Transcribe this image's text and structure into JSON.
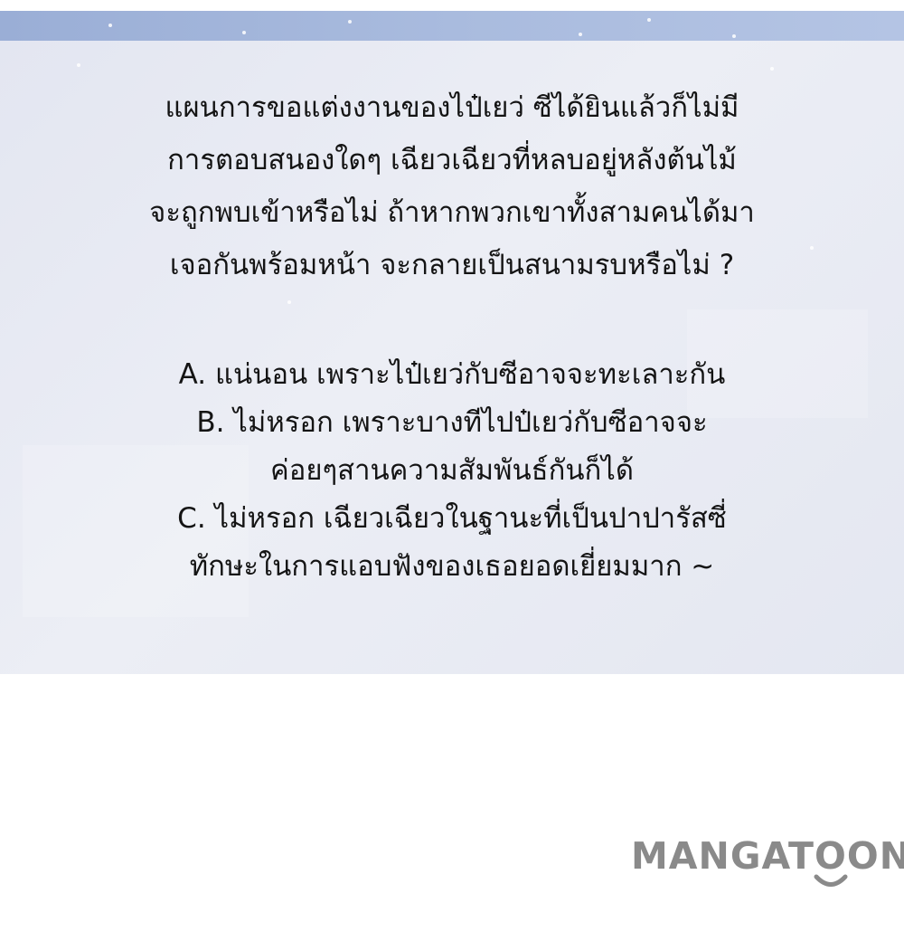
{
  "question": {
    "lines": [
      "แผนการขอแต่งงานของไป๋เยว่ ซีได้ยินแล้วก็ไม่มี",
      "การตอบสนองใดๆ เฉียวเฉียวที่หลบอยู่หลังต้นไม้",
      "จะถูกพบเข้าหรือไม่ ถ้าหากพวกเขาทั้งสามคนได้มา",
      "เจอกันพร้อมหน้า จะกลายเป็นสนามรบหรือไม่ ?"
    ]
  },
  "answers": {
    "lines": [
      "A. แน่นอน เพราะไป๋เยว่กับซีอาจจะทะเลาะกัน",
      "B. ไม่หรอก เพราะบางทีไปป๋เยว่กับซีอาจจะ",
      "ค่อยๆสานความสัมพันธ์กันก็ได้",
      "C. ไม่หรอก เฉียวเฉียวในฐานะที่เป็นปาปารัสซี่",
      "ทักษะในการแอบฟังของเธอยอดเยี่ยมมาก ~"
    ]
  },
  "watermark": {
    "text": "MANGATOON",
    "icon": "smile-icon",
    "color": "#8a8a8a"
  },
  "colors": {
    "panel_top": "#9fb3d9",
    "panel_body": "#e9ebf4",
    "text": "#141414",
    "page_background": "#ffffff"
  }
}
